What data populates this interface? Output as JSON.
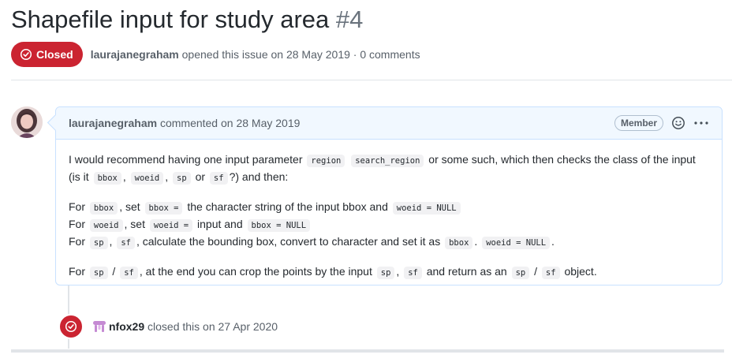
{
  "issue": {
    "title": "Shapefile input for study area",
    "number": "#4",
    "state": "Closed",
    "author": "laurajanegraham",
    "opened_text": "opened this issue on 28 May 2019 · 0 comments"
  },
  "comment": {
    "author": "laurajanegraham",
    "action": "commented on 28 May 2019",
    "badge": "Member",
    "body": {
      "p1": {
        "t1": "I would recommend having one input parameter ",
        "c1": "region",
        "c2": "search_region",
        "t2": " or some such, which then checks the class of the input (is it ",
        "c3": "bbox",
        "t3": ", ",
        "c4": "woeid",
        "t4": ", ",
        "c5": "sp",
        "t5": " or ",
        "c6": "sf",
        "t6": "?) and then:"
      },
      "p2": {
        "l1_t1": "For ",
        "l1_c1": "bbox",
        "l1_t2": ", set ",
        "l1_c2": "bbox =",
        "l1_t3": " the character string of the input bbox and ",
        "l1_c3": "woeid = NULL",
        "l2_t1": "For ",
        "l2_c1": "woeid",
        "l2_t2": ", set ",
        "l2_c2": "woeid =",
        "l2_t3": " input and ",
        "l2_c3": "bbox = NULL",
        "l3_t1": "For ",
        "l3_c1": "sp",
        "l3_t2": ", ",
        "l3_c2": "sf",
        "l3_t3": ", calculate the bounding box, convert to character and set it as ",
        "l3_c3": "bbox",
        "l3_t4": ". ",
        "l3_c4": "woeid = NULL",
        "l3_t5": "."
      },
      "p3": {
        "t1": "For ",
        "c1": "sp",
        "t2": " / ",
        "c2": "sf",
        "t3": ", at the end you can crop the points by the input ",
        "c3": "sp",
        "t4": ", ",
        "c4": "sf",
        "t5": " and return as an ",
        "c5": "sp",
        "t6": " / ",
        "c6": "sf",
        "t7": " object."
      }
    }
  },
  "event": {
    "author": "nfox29",
    "action": "closed this on 27 Apr 2020"
  },
  "icons": {
    "state": "issue-closed-icon",
    "reaction": "smiley-icon",
    "more": "kebab-horizontal-icon",
    "bot_avatar": "bot-avatar-icon"
  },
  "colors": {
    "closed_red": "#cb2431",
    "comment_border": "#c8e1ff",
    "comment_header_bg": "#f1f8ff"
  }
}
